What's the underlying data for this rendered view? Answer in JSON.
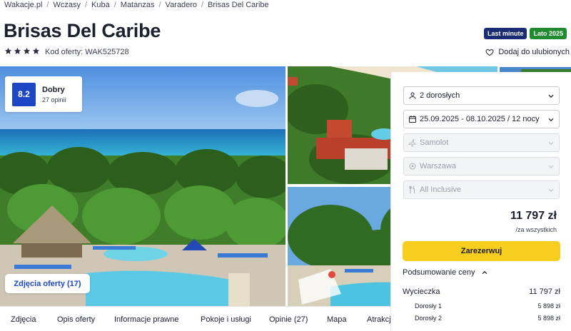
{
  "breadcrumb": [
    "Wakacje.pl",
    "Wczasy",
    "Kuba",
    "Matanzas",
    "Varadero",
    "Brisas Del Caribe"
  ],
  "hotel": {
    "name": "Brisas Del Caribe",
    "stars": 4,
    "offer_code": "Kod oferty: WAK525728",
    "badges": [
      {
        "label": "Last minute",
        "color": "#1a2d73"
      },
      {
        "label": "Lato 2025",
        "color": "#1f8a2f"
      }
    ],
    "favorite_label": "Dodaj do ulubionych"
  },
  "rating": {
    "score": "8.2",
    "label": "Dobry",
    "count": "27 opinii"
  },
  "gallery": {
    "photos_button": "Zdjęcia oferty (17)"
  },
  "booking": {
    "fields": [
      {
        "icon": "person-icon",
        "value": "2 dorosłych",
        "disabled": false
      },
      {
        "icon": "calendar-icon",
        "value": "25.09.2025 - 08.10.2025 / 12 nocy",
        "disabled": false
      },
      {
        "icon": "plane-icon",
        "value": "Samolot",
        "disabled": true
      },
      {
        "icon": "location-pin-icon",
        "value": "Warszawa",
        "disabled": true
      },
      {
        "icon": "cutlery-icon",
        "value": "All Inclusive",
        "disabled": true
      }
    ],
    "price": "11 797 zł",
    "price_note": "/za wszystkich",
    "reserve_label": "Zarezerwuj",
    "summary_label": "Podsumowanie ceny",
    "summary": {
      "trip_label": "Wycieczka",
      "trip_value": "11 797 zł",
      "items": [
        {
          "label": "Dorosły 1",
          "value": "5 898 zł"
        },
        {
          "label": "Dorosły 2",
          "value": "5 898 zł"
        }
      ]
    }
  },
  "tabs": [
    "Zdjęcia",
    "Opis oferty",
    "Informacje prawne",
    "Pokoje i usługi",
    "Opinie (27)",
    "Mapa",
    "Atrakcje"
  ],
  "colors": {
    "accent_blue": "#1d46c5",
    "reserve_yellow": "#f7ce1e",
    "text_dark": "#1b1f2e"
  }
}
